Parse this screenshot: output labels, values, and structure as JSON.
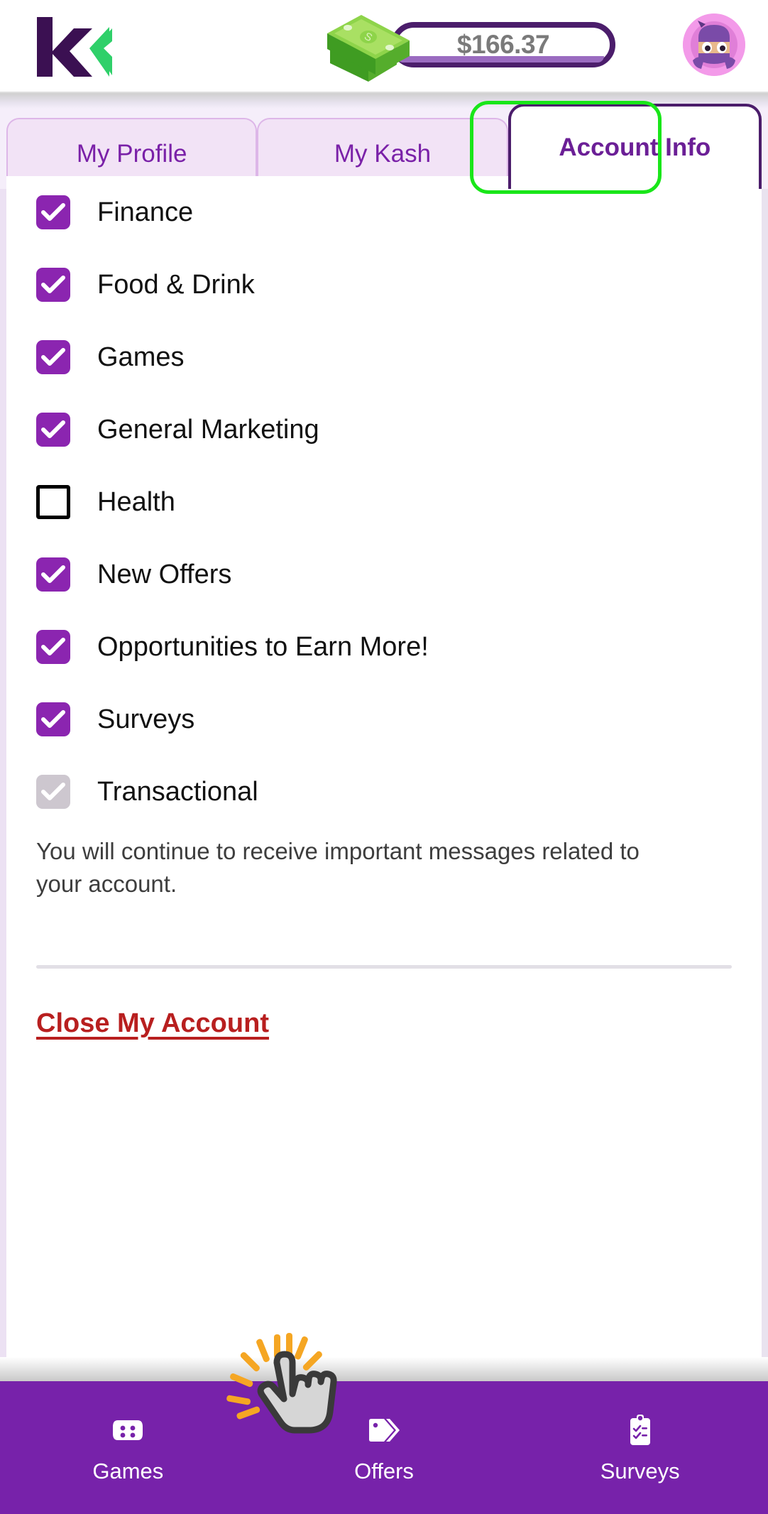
{
  "header": {
    "logo_name": "kashkick-logo",
    "balance": "$166.37",
    "cash_icon": "money-stack-icon",
    "avatar_name": "ninja-avatar"
  },
  "tabs": [
    {
      "label": "My Profile",
      "active": false
    },
    {
      "label": "My Kash",
      "active": false
    },
    {
      "label": "Account Info",
      "active": true
    }
  ],
  "preferences": {
    "items": [
      {
        "label": "Finance",
        "state": "checked"
      },
      {
        "label": "Food & Drink",
        "state": "checked"
      },
      {
        "label": "Games",
        "state": "checked"
      },
      {
        "label": "General Marketing",
        "state": "checked"
      },
      {
        "label": "Health",
        "state": "unchecked"
      },
      {
        "label": "New Offers",
        "state": "checked"
      },
      {
        "label": "Opportunities to Earn More!",
        "state": "checked"
      },
      {
        "label": "Surveys",
        "state": "checked"
      },
      {
        "label": "Transactional",
        "state": "disabled"
      }
    ],
    "helper_text": "You will continue to receive important messages related to your account."
  },
  "account_actions": {
    "close_account_label": "Close My Account"
  },
  "bottom_nav": [
    {
      "label": "Games",
      "icon": "gamepad-icon"
    },
    {
      "label": "Offers",
      "icon": "tag-icon"
    },
    {
      "label": "Surveys",
      "icon": "clipboard-checklist-icon"
    }
  ],
  "colors": {
    "brand_purple": "#7722aa",
    "dark_purple": "#4b1d6b",
    "checkbox_purple": "#8b25b0",
    "tab_inactive_bg": "#f2e3f6",
    "focus_green": "#19e619",
    "danger_red": "#b81f1f",
    "disabled_grey": "#cdc7cf"
  }
}
